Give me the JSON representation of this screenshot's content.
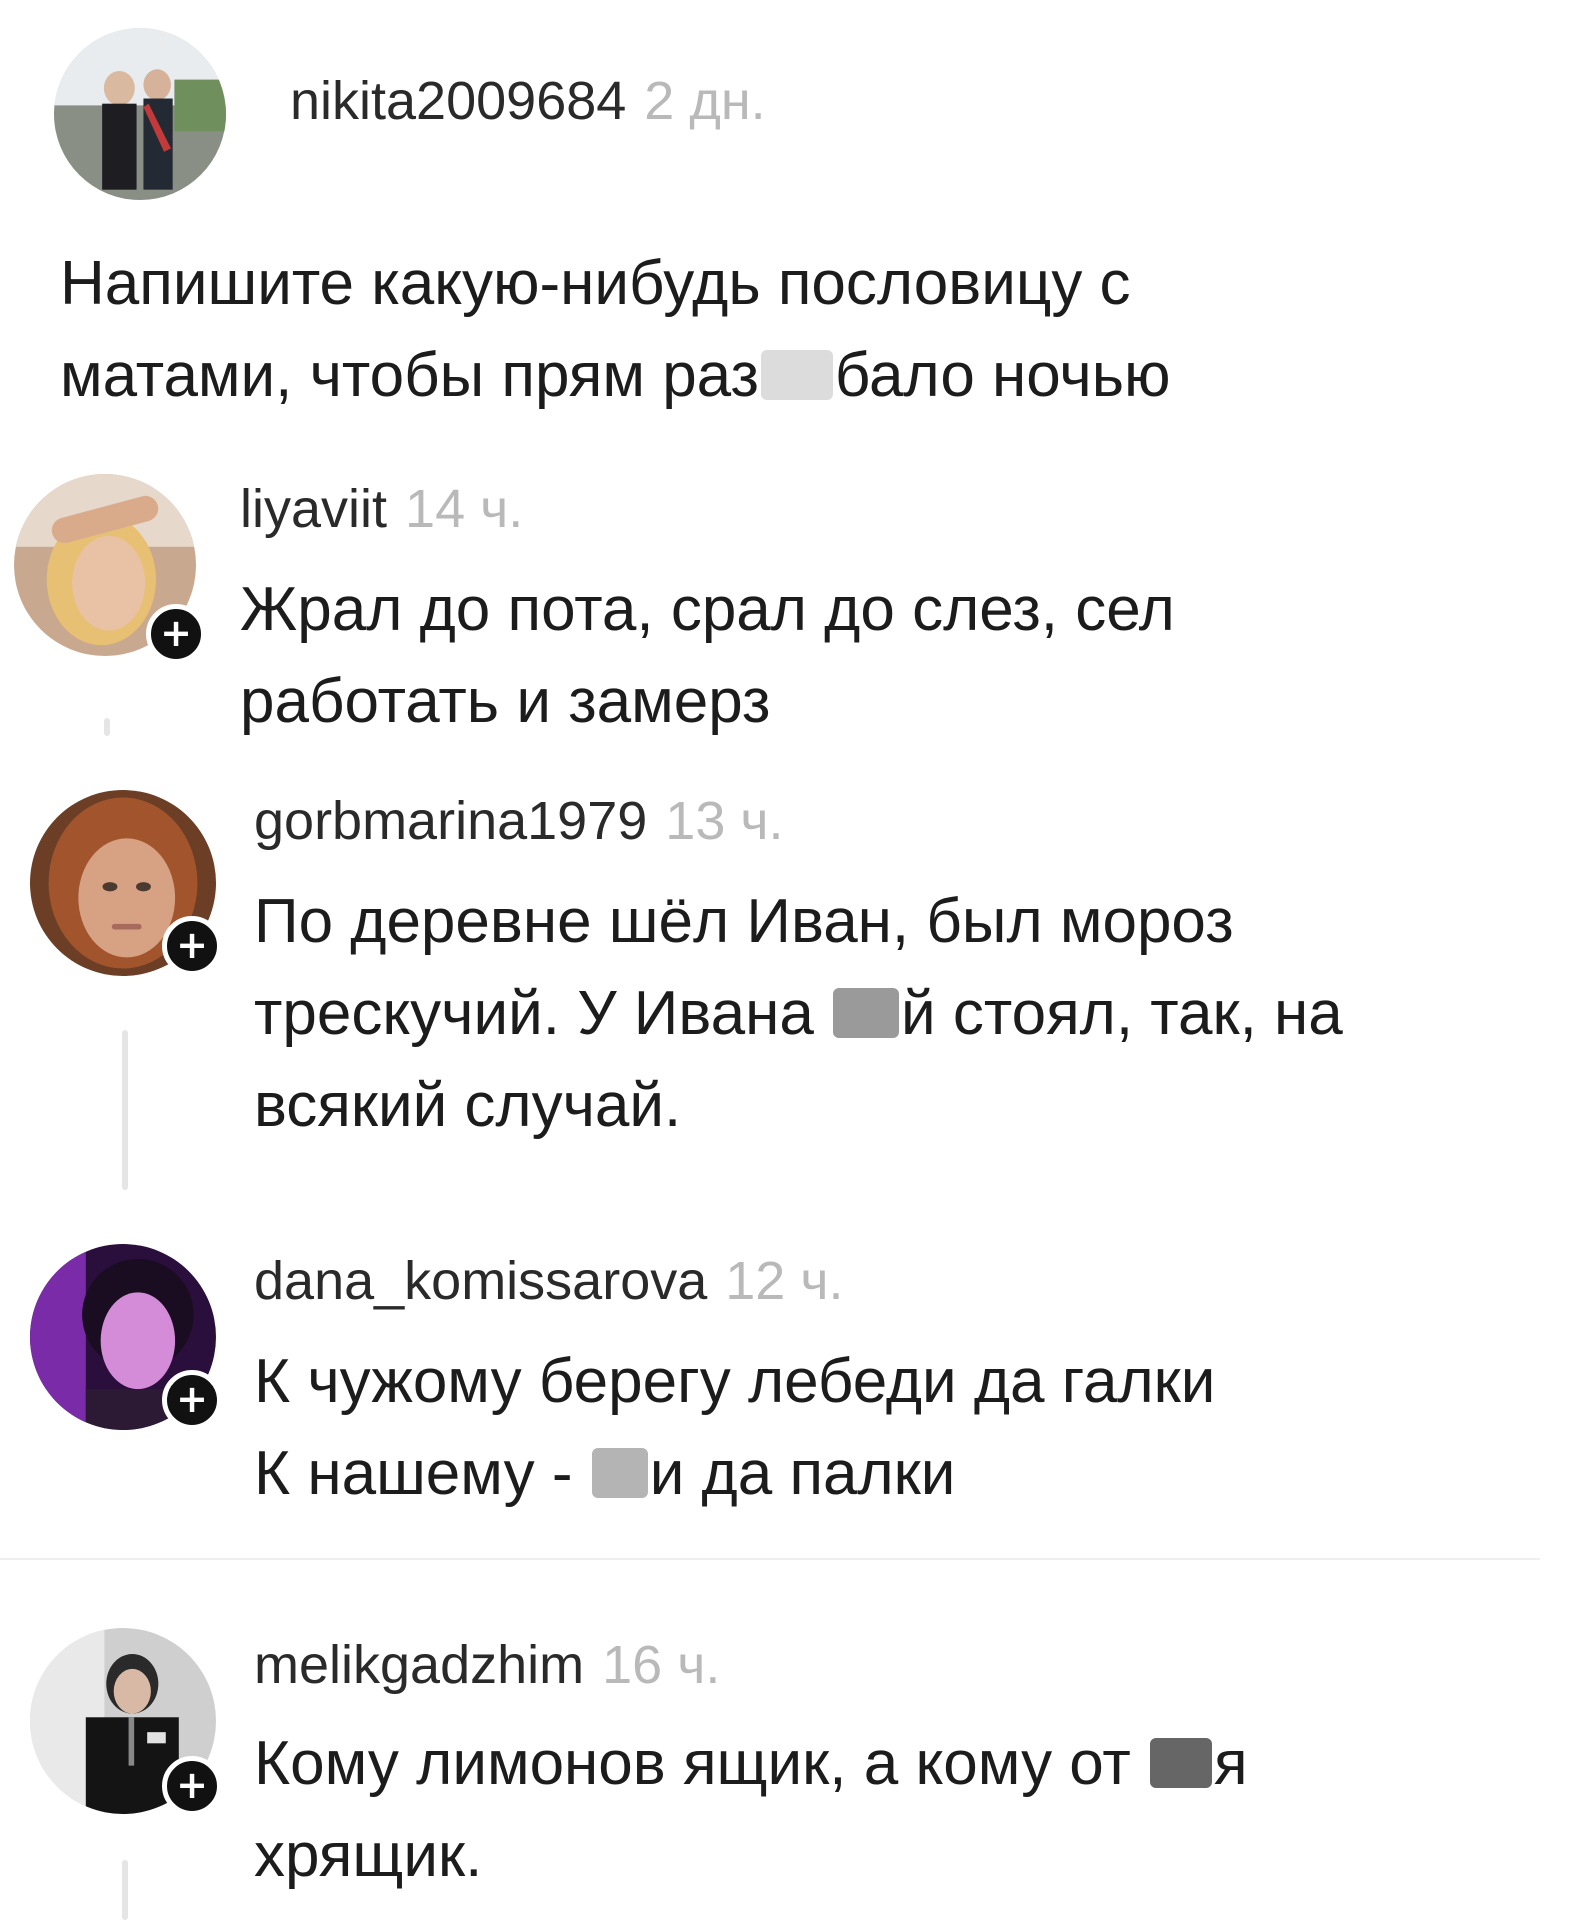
{
  "post": {
    "username": "nikita2009684",
    "time": "2 дн.",
    "text_line1": "Напишите какую-нибудь пословицу с",
    "text_line2_a": "матами, чтобы прям раз",
    "text_line2_b": "бало ночью"
  },
  "comments": [
    {
      "username": "liyaviit",
      "time": "14 ч.",
      "line1": "Жрал до пота, срал до слез, сел",
      "line2": "работать и замерз"
    },
    {
      "username": "gorbmarina1979",
      "time": "13 ч.",
      "line1": "По деревне шёл Иван, был мороз",
      "line2_a": "трескучий. У Ивана ",
      "line2_b": "й стоял, так, на",
      "line3": "всякий случай."
    },
    {
      "username": "dana_komissarova",
      "time": "12 ч.",
      "line1": "К чужому берегу лебеди да галки",
      "line2_a": "К нашему - ",
      "line2_b": "и да палки"
    },
    {
      "username": "melikgadzhim",
      "time": "16 ч.",
      "line1_a": "Кому лимонов ящик, а кому от ",
      "line1_b": "я",
      "line2": "хрящик."
    }
  ],
  "follow_symbol": "+",
  "colors": {
    "background": "#ffffff",
    "text": "#1c1c1c",
    "timestamp": "#b9b9b9",
    "follow_badge": "#111111"
  }
}
